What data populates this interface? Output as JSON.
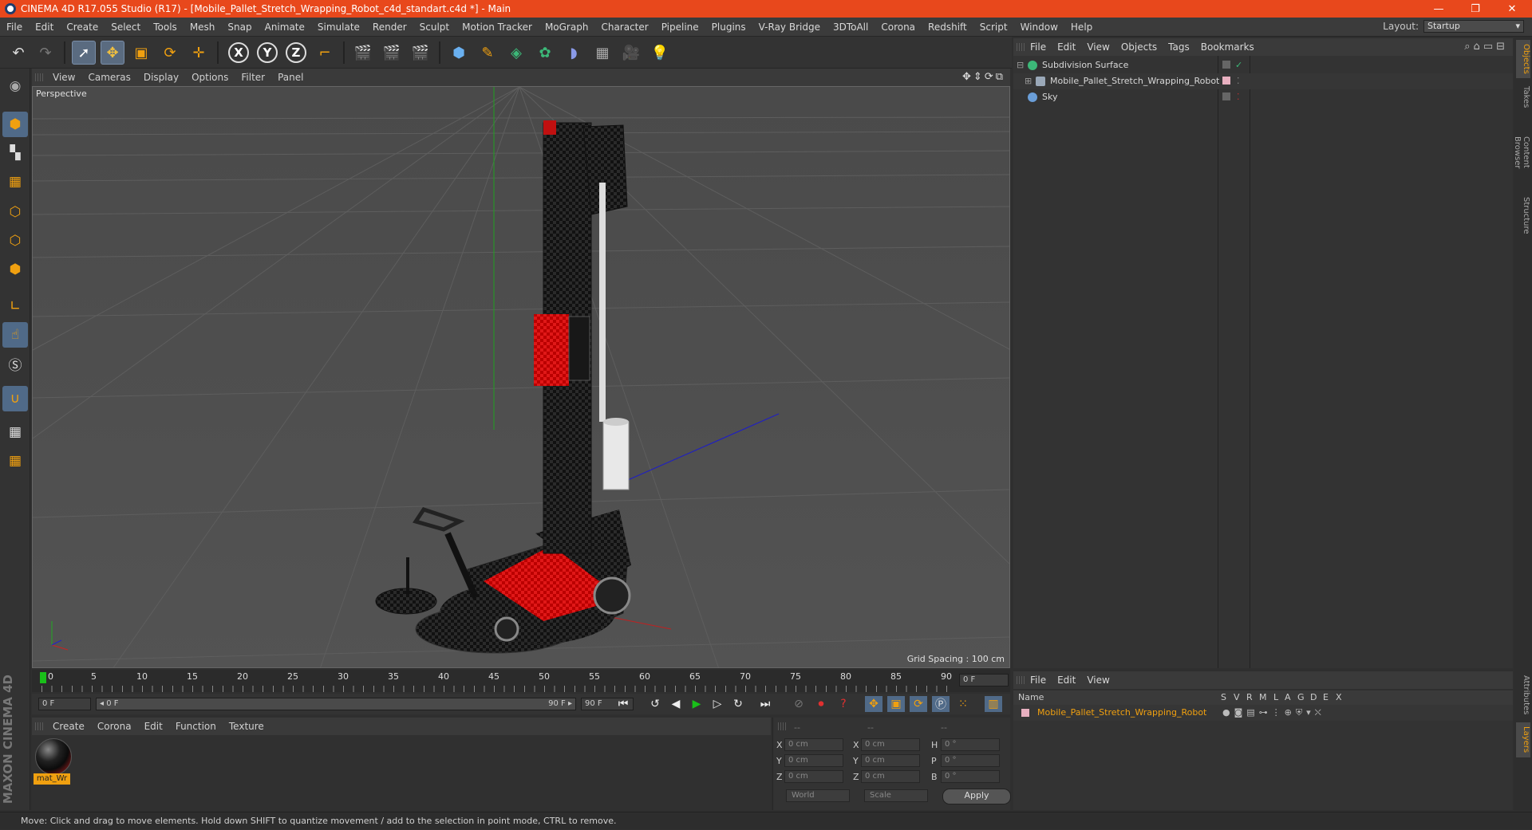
{
  "window": {
    "title": "CINEMA 4D R17.055 Studio (R17) - [Mobile_Pallet_Stretch_Wrapping_Robot_c4d_standart.c4d *] - Main",
    "minimize": "—",
    "maximize": "❐",
    "close": "✕"
  },
  "menu": [
    "File",
    "Edit",
    "Create",
    "Select",
    "Tools",
    "Mesh",
    "Snap",
    "Animate",
    "Simulate",
    "Render",
    "Sculpt",
    "Motion Tracker",
    "MoGraph",
    "Character",
    "Pipeline",
    "Plugins",
    "V-Ray Bridge",
    "3DToAll",
    "Corona",
    "Redshift",
    "Script",
    "Window",
    "Help"
  ],
  "layout": {
    "label": "Layout:",
    "value": "Startup"
  },
  "axes": {
    "x": "X",
    "y": "Y",
    "z": "Z"
  },
  "viewport": {
    "menu": [
      "View",
      "Cameras",
      "Display",
      "Options",
      "Filter",
      "Panel"
    ],
    "nav_icons": "✥⇕⟳⧉",
    "label": "Perspective",
    "grid_spacing": "Grid Spacing : 100 cm"
  },
  "timeline": {
    "ticks": [
      "0",
      "5",
      "10",
      "15",
      "20",
      "25",
      "30",
      "35",
      "40",
      "45",
      "50",
      "55",
      "60",
      "65",
      "70",
      "75",
      "80",
      "85",
      "90"
    ],
    "current": "0 F"
  },
  "transport": {
    "start": "0 F",
    "range_start": "◂ 0 F",
    "range_end": "90 F ▸",
    "end": "90 F"
  },
  "materials": {
    "menu": [
      "Create",
      "Corona",
      "Edit",
      "Function",
      "Texture"
    ],
    "items": [
      {
        "name": "mat_Wr"
      }
    ]
  },
  "coordinates": {
    "headers": [
      "--",
      "--",
      "--"
    ],
    "rows": [
      {
        "a": "X",
        "av": "0 cm",
        "b": "X",
        "bv": "0 cm",
        "c": "H",
        "cv": "0 °"
      },
      {
        "a": "Y",
        "av": "0 cm",
        "b": "Y",
        "bv": "0 cm",
        "c": "P",
        "cv": "0 °"
      },
      {
        "a": "Z",
        "av": "0 cm",
        "b": "Z",
        "bv": "0 cm",
        "c": "B",
        "cv": "0 °"
      }
    ],
    "space": "World",
    "mode": "Scale",
    "apply": "Apply"
  },
  "status": "Move: Click and drag to move elements. Hold down SHIFT to quantize movement / add to the selection in point mode, CTRL to remove.",
  "object_manager": {
    "menu": [
      "File",
      "Edit",
      "View",
      "Objects",
      "Tags",
      "Bookmarks"
    ],
    "icons": "⌕⌂▭⊟",
    "objects": [
      {
        "name": "Subdivision Surface",
        "color": "#3cb878"
      },
      {
        "name": "Mobile_Pallet_Stretch_Wrapping_Robot",
        "color": "#9aa8b8"
      },
      {
        "name": "Sky",
        "color": "#6a9ed8"
      }
    ]
  },
  "right_tabs": [
    "Objects",
    "Takes",
    "Content Browser",
    "Structure"
  ],
  "right_tabs_lower": [
    "Attributes",
    "Layers"
  ],
  "layer_manager": {
    "menu": [
      "File",
      "Edit",
      "View"
    ],
    "columns": [
      "Name",
      "S",
      "V",
      "R",
      "M",
      "L",
      "A",
      "G",
      "D",
      "E",
      "X"
    ],
    "layers": [
      {
        "name": "Mobile_Pallet_Stretch_Wrapping_Robot",
        "color": "#f0a010"
      }
    ]
  },
  "brand": {
    "vertical_logo": "MAXON CINEMA 4D"
  }
}
